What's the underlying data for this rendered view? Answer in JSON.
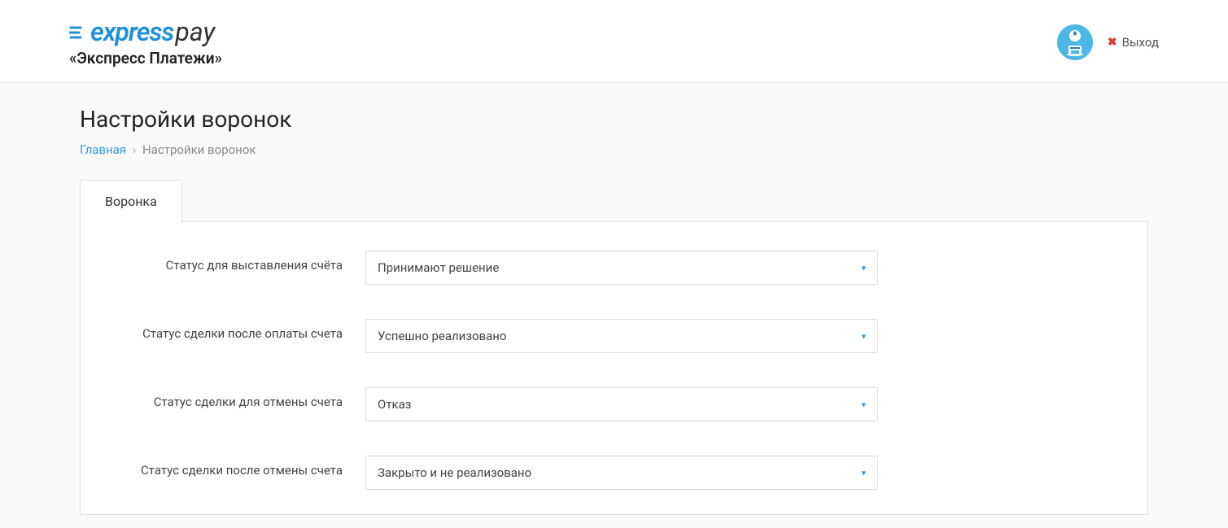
{
  "header": {
    "logo_express": "express",
    "logo_pay": "pay",
    "logo_subtitle": "«Экспресс Платежи»",
    "logout_label": "Выход"
  },
  "page": {
    "title": "Настройки воронок"
  },
  "breadcrumb": {
    "home": "Главная",
    "current": "Настройки воронок"
  },
  "tab": {
    "label": "Воронка"
  },
  "form": {
    "rows": [
      {
        "label": "Статус для выставления счёта",
        "value": "Принимают решение"
      },
      {
        "label": "Статус сделки после оплаты счета",
        "value": "Успешно реализовано"
      },
      {
        "label": "Статус сделки для отмены счета",
        "value": "Отказ"
      },
      {
        "label": "Статус сделки после отмены счета",
        "value": "Закрыто и не реализовано"
      }
    ]
  }
}
